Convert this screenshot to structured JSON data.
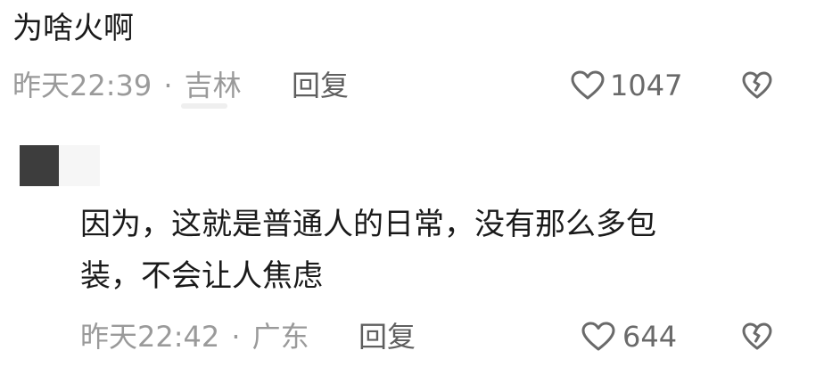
{
  "comments": [
    {
      "text": "为啥火啊",
      "time": "昨天22:39",
      "sep": "·",
      "location": "吉林",
      "reply": "回复",
      "likes": "1047"
    },
    {
      "text_line1": "因为，这就是普通人的日常，没有那么多包",
      "text_line2": "装，不会让人焦虑",
      "time": "昨天22:42",
      "sep": "·",
      "location": "广东",
      "reply": "回复",
      "likes": "644"
    }
  ],
  "icons": {
    "like": "heart-icon",
    "dislike": "broken-heart-icon"
  }
}
